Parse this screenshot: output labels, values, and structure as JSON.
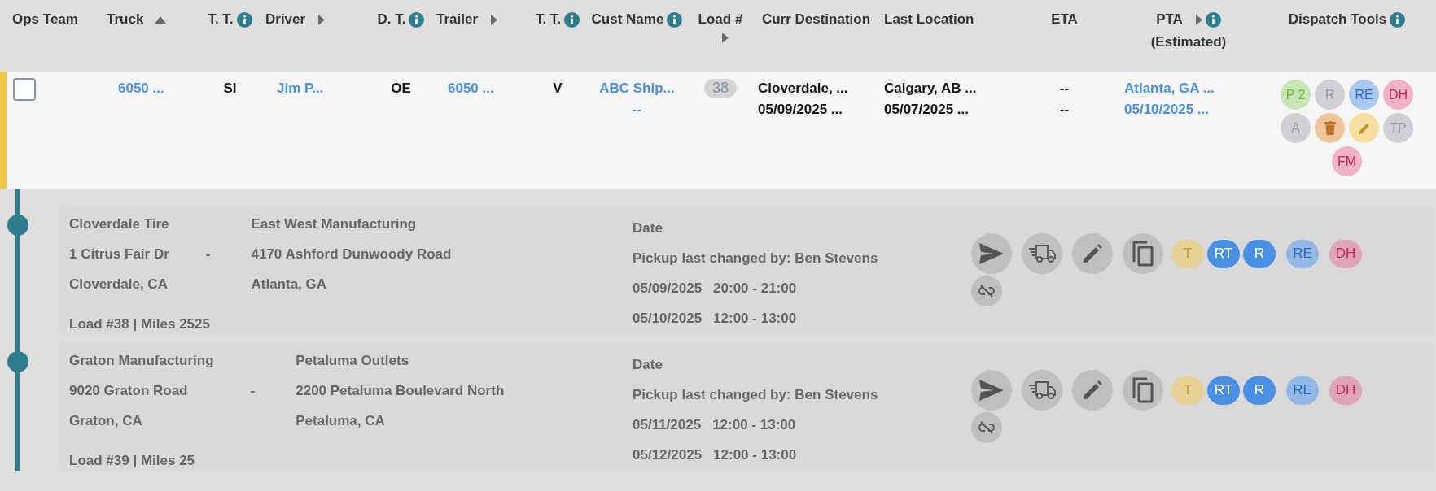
{
  "columns": [
    {
      "label": "Ops Team",
      "info": false,
      "sorted": false,
      "expandable": false
    },
    {
      "label": "Truck",
      "info": false,
      "sorted": true,
      "expandable": false
    },
    {
      "label": "T. T.",
      "info": true,
      "sorted": false,
      "expandable": false
    },
    {
      "label": "Driver",
      "info": false,
      "sorted": false,
      "expandable": true
    },
    {
      "label": "D. T.",
      "info": true,
      "sorted": false,
      "expandable": false
    },
    {
      "label": "Trailer",
      "info": false,
      "sorted": false,
      "expandable": true
    },
    {
      "label": "T. T.",
      "info": true,
      "sorted": false,
      "expandable": false
    },
    {
      "label": "Cust Name",
      "info": true,
      "sorted": false,
      "expandable": false
    },
    {
      "label": "Load #",
      "info": false,
      "sorted": false,
      "expandable": true
    },
    {
      "label": "Curr Destination",
      "info": false,
      "sorted": false,
      "expandable": false
    },
    {
      "label": "Last Location",
      "info": false,
      "sorted": false,
      "expandable": false
    },
    {
      "label": "ETA",
      "info": false,
      "sorted": false,
      "expandable": false
    },
    {
      "label": "PTA",
      "sublabel": "(Estimated)",
      "info": true,
      "sorted": false,
      "expandable": true
    },
    {
      "label": "Dispatch Tools",
      "info": true,
      "sorted": false,
      "expandable": false
    }
  ],
  "row": {
    "color": "#f2c443",
    "cells": [
      {
        "kind": "checkbox",
        "checked": false
      },
      {
        "kind": "link",
        "lines": [
          "6050 ..."
        ]
      },
      {
        "kind": "text",
        "lines": [
          "SI"
        ]
      },
      {
        "kind": "link",
        "lines": [
          "Jim P..."
        ]
      },
      {
        "kind": "text",
        "lines": [
          "OE"
        ]
      },
      {
        "kind": "link",
        "lines": [
          "6050 ..."
        ]
      },
      {
        "kind": "text",
        "lines": [
          "V"
        ]
      },
      {
        "kind": "link",
        "lines": [
          "ABC Ship...",
          "--"
        ]
      },
      {
        "kind": "badge",
        "lines": [
          "38"
        ]
      },
      {
        "kind": "text",
        "lines": [
          "Cloverdale, ...",
          "05/09/2025 ..."
        ]
      },
      {
        "kind": "text",
        "lines": [
          "Calgary, AB ...",
          "05/07/2025 ..."
        ]
      },
      {
        "kind": "text",
        "lines": [
          "--",
          "--"
        ]
      },
      {
        "kind": "link",
        "lines": [
          "Atlanta, GA ...",
          "05/10/2025 ..."
        ]
      },
      {
        "kind": "tools",
        "tools": [
          {
            "kind": "letter",
            "label": "P 2",
            "color": "#c9e5b5"
          },
          {
            "kind": "letter",
            "label": "R",
            "color": "#cfd0d4"
          },
          {
            "kind": "letter",
            "label": "RE",
            "color": "#a9c9f1"
          },
          {
            "kind": "letter",
            "label": "DH",
            "color": "#f1b3c7"
          },
          {
            "kind": "letter",
            "label": "A",
            "color": "#cfd0d4"
          },
          {
            "kind": "delete",
            "color": "#f1c59a"
          },
          {
            "kind": "edit",
            "color": "#f5e0a2"
          },
          {
            "kind": "letter",
            "label": "TP",
            "color": "#cfd0d4"
          },
          {
            "kind": "letter",
            "label": "FM",
            "color": "#f1b3c7"
          }
        ]
      }
    ]
  },
  "loads": [
    {
      "origin": {
        "name": "Cloverdale Tire",
        "address": "1 Citrus Fair Dr",
        "city": "Cloverdale, CA"
      },
      "separator": "-",
      "destination": {
        "name": "East West Manufacturing",
        "address": "4170 Ashford Dunwoody Road",
        "city": "Atlanta, GA"
      },
      "summary": "Load #38 | Miles 2525",
      "date_label": "Date",
      "changed_by": "Pickup last changed by: Ben Stevens",
      "windows": [
        {
          "date": "05/09/2025",
          "time": "20:00 - 21:00"
        },
        {
          "date": "05/10/2025",
          "time": "12:00 - 13:00"
        }
      ],
      "badges": [
        {
          "label": "T",
          "color": "#e6d194"
        },
        {
          "label": "RT",
          "color": "#4a90e2"
        },
        {
          "label": "R",
          "color": "#4a90e2"
        },
        {
          "label": "RE",
          "color": "#94b8e4"
        },
        {
          "label": "DH",
          "color": "#e0a4b8"
        }
      ]
    },
    {
      "origin": {
        "name": "Graton Manufacturing",
        "address": "9020 Graton Road",
        "city": "Graton, CA"
      },
      "separator": "-",
      "destination": {
        "name": "Petaluma Outlets",
        "address": "2200 Petaluma Boulevard North",
        "city": "Petaluma, CA"
      },
      "summary": "Load #39 | Miles 25",
      "date_label": "Date",
      "changed_by": "Pickup last changed by: Ben Stevens",
      "windows": [
        {
          "date": "05/11/2025",
          "time": "12:00 - 13:00"
        },
        {
          "date": "05/12/2025",
          "time": "12:00 - 13:00"
        }
      ],
      "badges": [
        {
          "label": "T",
          "color": "#e6d194"
        },
        {
          "label": "RT",
          "color": "#4a90e2"
        },
        {
          "label": "R",
          "color": "#4a90e2"
        },
        {
          "label": "RE",
          "color": "#94b8e4"
        },
        {
          "label": "DH",
          "color": "#e0a4b8"
        }
      ]
    }
  ]
}
